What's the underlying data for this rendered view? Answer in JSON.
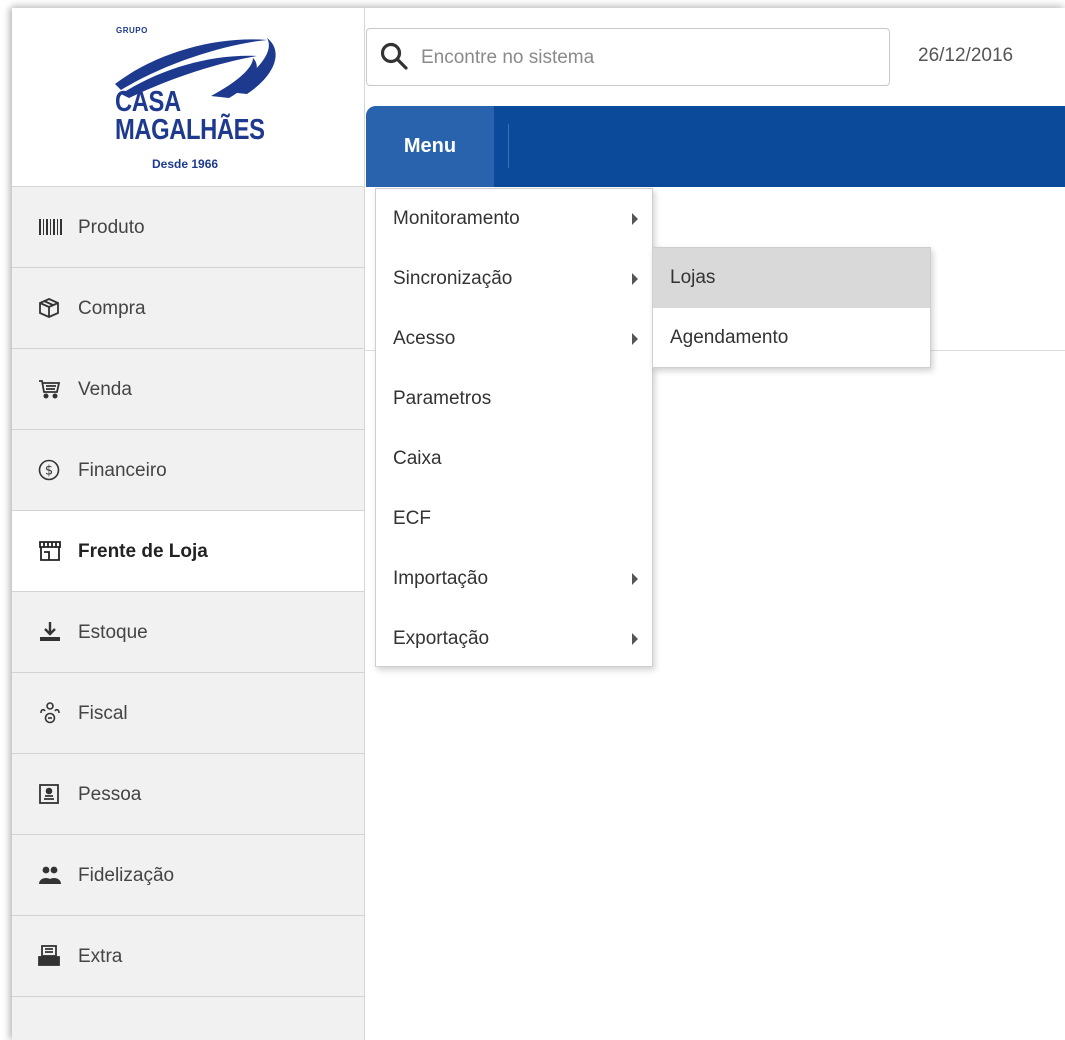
{
  "logo": {
    "grupo": "GRUPO",
    "line1": "CASA",
    "line2": "MAGALHÃES",
    "since": "Desde 1966"
  },
  "search": {
    "placeholder": "Encontre no sistema",
    "value": ""
  },
  "header": {
    "date": "26/12/2016",
    "menu_label": "Menu"
  },
  "colors": {
    "menubar": "#0b4a9a",
    "menu_button": "#2a63ad",
    "brand": "#1d3a8f"
  },
  "sidebar": {
    "items": [
      {
        "label": "Produto",
        "icon": "barcode-icon",
        "active": false
      },
      {
        "label": "Compra",
        "icon": "box-icon",
        "active": false
      },
      {
        "label": "Venda",
        "icon": "cart-icon",
        "active": false
      },
      {
        "label": "Financeiro",
        "icon": "dollar-icon",
        "active": false
      },
      {
        "label": "Frente de Loja",
        "icon": "store-icon",
        "active": true
      },
      {
        "label": "Estoque",
        "icon": "download-icon",
        "active": false
      },
      {
        "label": "Fiscal",
        "icon": "tax-icon",
        "active": false
      },
      {
        "label": "Pessoa",
        "icon": "id-card-icon",
        "active": false
      },
      {
        "label": "Fidelização",
        "icon": "people-icon",
        "active": false
      },
      {
        "label": "Extra",
        "icon": "printer-icon",
        "active": false
      }
    ]
  },
  "dropdown": {
    "items": [
      {
        "label": "Monitoramento",
        "has_submenu": true
      },
      {
        "label": "Sincronização",
        "has_submenu": true
      },
      {
        "label": "Acesso",
        "has_submenu": true
      },
      {
        "label": "Parametros",
        "has_submenu": false
      },
      {
        "label": "Caixa",
        "has_submenu": false
      },
      {
        "label": "ECF",
        "has_submenu": false
      },
      {
        "label": "Importação",
        "has_submenu": true
      },
      {
        "label": "Exportação",
        "has_submenu": true
      }
    ]
  },
  "submenu": {
    "items": [
      {
        "label": "Lojas",
        "hovered": true
      },
      {
        "label": "Agendamento",
        "hovered": false
      }
    ]
  }
}
